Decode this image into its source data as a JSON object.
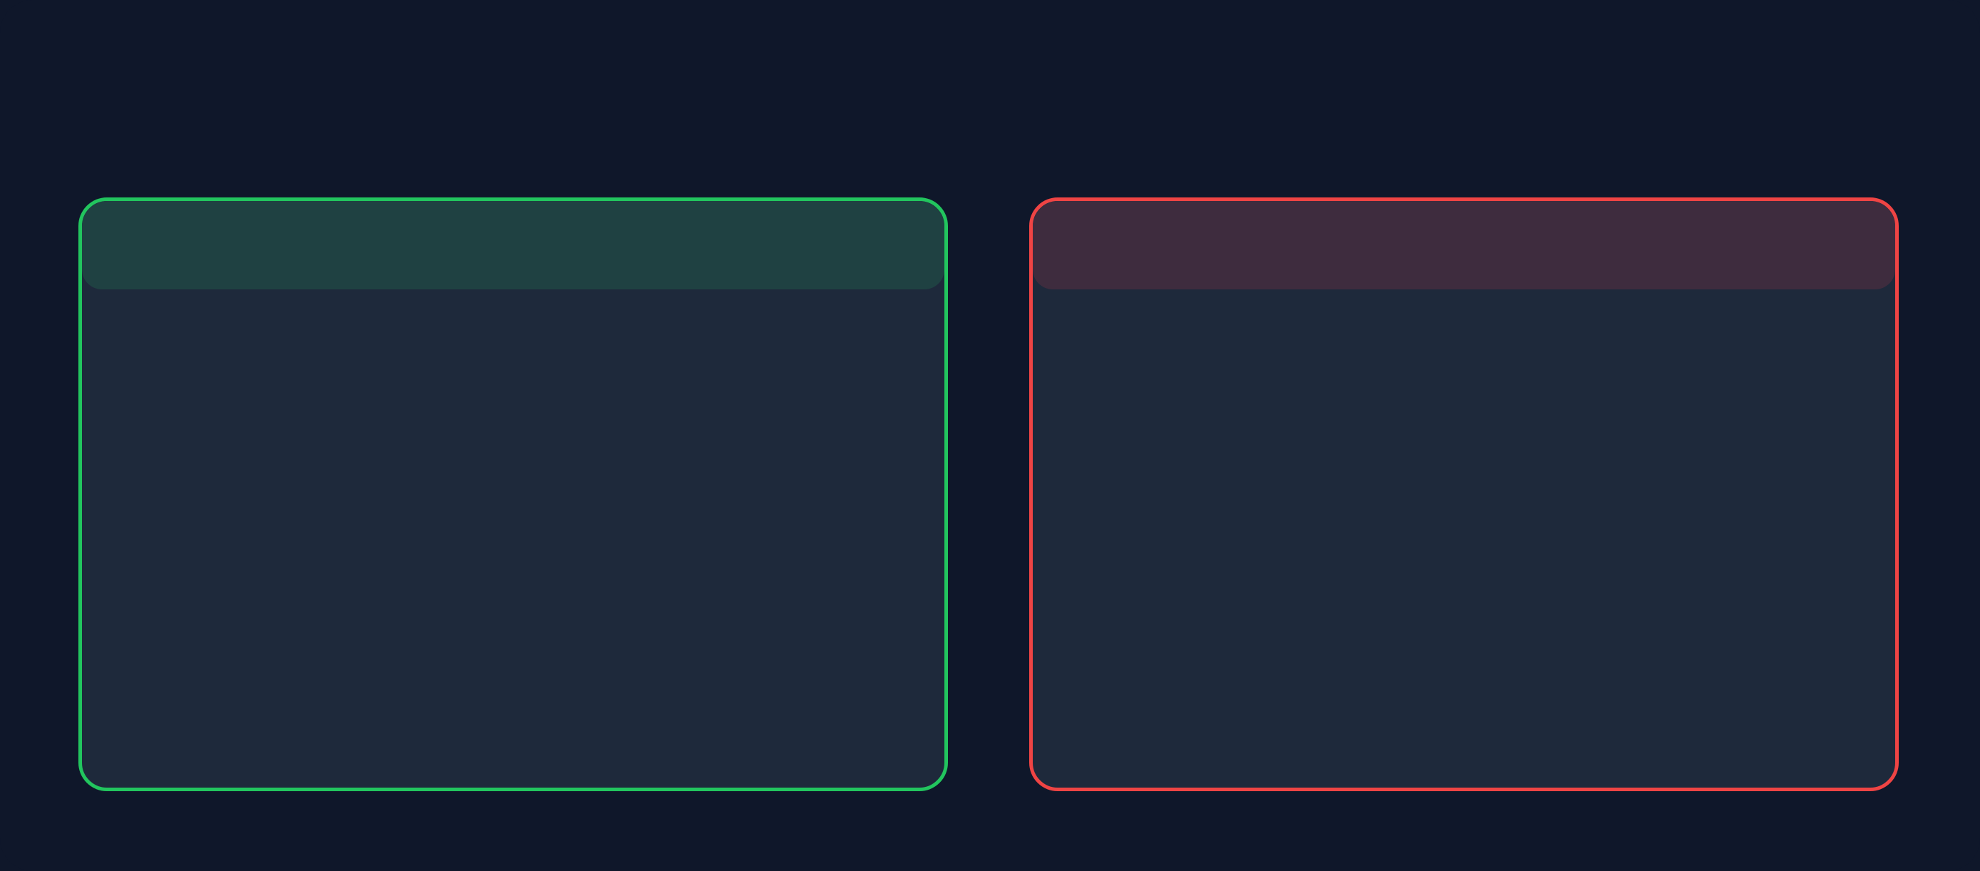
{
  "title": "",
  "left_panel": {
    "title": "",
    "lines": [
      "",
      "",
      "",
      "",
      "",
      ""
    ]
  },
  "right_panel": {
    "title": "",
    "lines": [
      "",
      "",
      "",
      "",
      "",
      "",
      ""
    ]
  },
  "caption": "",
  "colors": {
    "background": "#0f172a",
    "panel_fill": "#1e293b",
    "left_accent": "#22c55e",
    "right_accent": "#ef4444",
    "body_text": "#ffffff",
    "caption_text": "#64748b"
  }
}
